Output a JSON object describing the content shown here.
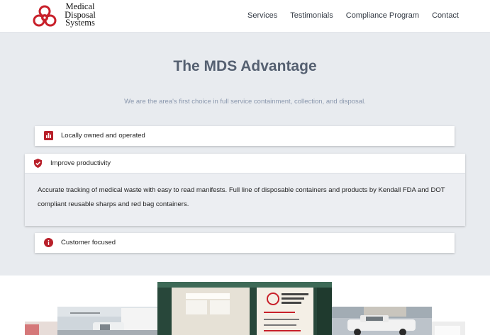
{
  "brand": {
    "line1": "Medical",
    "line2": "Disposal",
    "line3": "Systems",
    "accent": "#c8202a"
  },
  "nav": [
    {
      "label": "Services"
    },
    {
      "label": "Testimonials"
    },
    {
      "label": "Compliance Program"
    },
    {
      "label": "Contact"
    }
  ],
  "section": {
    "title": "The MDS Advantage",
    "subtitle": "We are the area's first choice in full service containment, collection, and disposal."
  },
  "accordion": [
    {
      "label": "Locally owned and operated",
      "icon": "bar-chart-icon",
      "expanded": false
    },
    {
      "label": "Improve productivity",
      "icon": "shield-check-icon",
      "expanded": true,
      "body_line1": "Accurate tracking of medical waste with easy to read manifests. Full line of disposable containers and products by Kendall FDA and DOT",
      "body_line2": "compliant reusable sharps and red bag containers."
    },
    {
      "label": "Customer focused",
      "icon": "info-icon",
      "expanded": false
    }
  ],
  "colors": {
    "section_bg": "#e8ebef",
    "title": "#556071",
    "subtitle": "#8a97ad",
    "icon_red": "#b8202a"
  }
}
